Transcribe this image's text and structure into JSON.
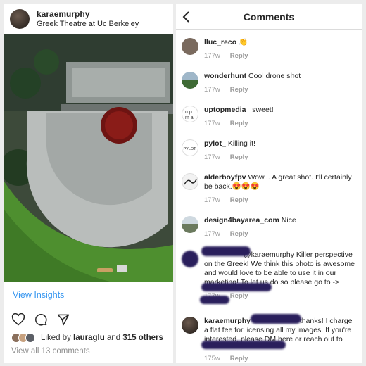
{
  "post": {
    "username": "karaemurphy",
    "location": "Greek Theatre at Uc Berkeley",
    "view_insights": "View Insights",
    "likes": {
      "prefix": "Liked by",
      "user": "lauraglu",
      "mid": "and",
      "count": "315 others"
    },
    "view_all_comments": "View all 13 comments",
    "icons": [
      "heart-icon",
      "comment-icon",
      "share-icon"
    ]
  },
  "comments_header": {
    "title": "Comments",
    "back_icon": "chevron-left-icon"
  },
  "comments": [
    {
      "user": "lluc_reco",
      "text": "👏",
      "age": "177w",
      "reply": "Reply"
    },
    {
      "user": "wonderhunt",
      "text": "Cool drone shot",
      "age": "177w",
      "reply": "Reply"
    },
    {
      "user": "uptopmedia_",
      "text": "sweet!",
      "age": "177w",
      "reply": "Reply"
    },
    {
      "user": "pylot_",
      "text": "Killing it!",
      "age": "177w",
      "reply": "Reply"
    },
    {
      "user": "alderboyfpv",
      "text": "Wow... A great shot. I'll certainly be back.😍😍😍",
      "age": "177w",
      "reply": "Reply"
    },
    {
      "user": "design4bayarea_com",
      "text": "Nice",
      "age": "177w",
      "reply": "Reply"
    },
    {
      "user": "",
      "text": "@karaemurphy Killer perspective on the Greek! We think this photo is awesome and would love to be able to use it in our marketing! To let us do so please go to ->",
      "age": "177w",
      "reply": "Reply"
    },
    {
      "user": "karaemurphy",
      "text": "thanks! I charge a flat fee for licensing all my images. If you're interested, please DM here or reach out to",
      "age": "175w",
      "reply": "Reply"
    }
  ],
  "colors": {
    "link_blue": "#3897f0",
    "redaction": "#2a1f5c",
    "meta_gray": "#999999"
  }
}
